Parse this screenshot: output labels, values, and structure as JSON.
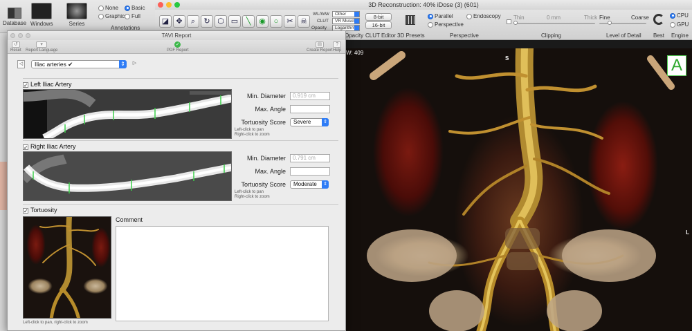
{
  "main_toolbar": {
    "database_label": "Database",
    "windows_label": "Windows",
    "series_label": "Series",
    "annotations_label": "Annotations",
    "annotation_options": [
      "None",
      "Basic",
      "Graphic",
      "Full"
    ],
    "annotation_selected": "Basic"
  },
  "recon": {
    "window_title": "3D Reconstruction: 40% iDose (3) (601)",
    "wlww_label": "WL/WW",
    "wlww_value": "Other",
    "clut_label": "CLUT",
    "clut_value": "VR Muscles-Bon",
    "opacity_label": "Opacity",
    "opacity_value": "Logarithmic Inve",
    "bit8_label": "8-bit",
    "bit16_label": "16-bit",
    "opacity_toolbar_label": "Opacity",
    "clut_editor_label": "CLUT Editor",
    "presets_label": "3D Presets",
    "perspective_options": [
      "Parallel",
      "Endoscopy",
      "Perspective"
    ],
    "perspective_selected": "Parallel",
    "perspective_label": "Perspective",
    "clipping_thin": "Thin",
    "clipping_value": "0 mm",
    "clipping_thick": "Thick",
    "clipping_label": "Clipping",
    "lod_fine": "Fine",
    "lod_coarse": "Coarse",
    "lod_label": "Level of Detail",
    "best_label": "Best",
    "engine_options": [
      "CPU",
      "GPU"
    ],
    "engine_selected": "CPU",
    "engine_label": "Engine",
    "view": {
      "ww_readout": "W: 409",
      "orientation_badge": "A",
      "orient_top": "S",
      "orient_right": "L"
    }
  },
  "tavi": {
    "window_title": "TAVI Report",
    "toolbar": {
      "reset": "Reset",
      "report_language": "Report Language",
      "pdf_report": "PDF Report",
      "create_report": "Create Report",
      "help": "Help"
    },
    "section_select": "Iliac arteries ✔",
    "left_artery": {
      "heading": "Left Iliac Artery",
      "min_diameter_label": "Min. Diameter",
      "min_diameter_value": "0.919 cm",
      "max_angle_label": "Max. Angle",
      "max_angle_value": "",
      "tortuosity_label": "Tortuosity Score",
      "tortuosity_value": "Severe",
      "hint_pan": "Left-click to pan",
      "hint_zoom": "Right-click to zoom"
    },
    "right_artery": {
      "heading": "Right Iliac Artery",
      "min_diameter_label": "Min. Diameter",
      "min_diameter_value": "0.791 cm",
      "max_angle_label": "Max. Angle",
      "max_angle_value": "",
      "tortuosity_label": "Tortuosity Score",
      "tortuosity_value": "Moderate",
      "hint_pan": "Left-click to pan",
      "hint_zoom": "Right-click to zoom"
    },
    "tortuosity": {
      "heading": "Tortuosity",
      "comment_label": "Comment",
      "comment_value": "",
      "hint": "Left-click to pan, right-click to zoom"
    }
  }
}
